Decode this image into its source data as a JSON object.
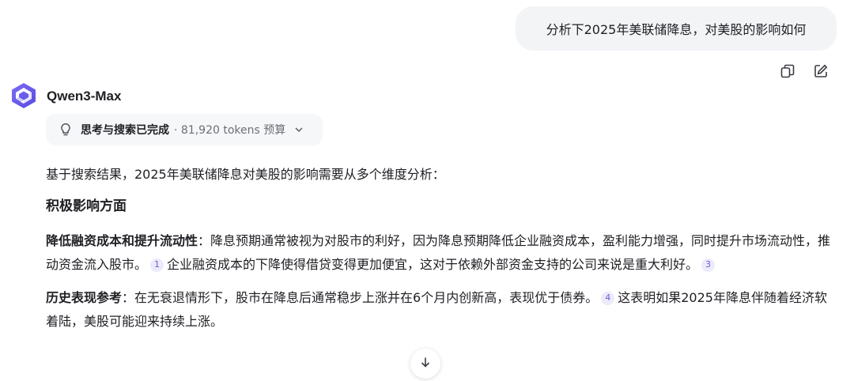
{
  "user_message": "分析下2025年美联储降息，对美股的影响如何",
  "actions": {
    "copy_icon": "copy-icon",
    "edit_icon": "edit-icon"
  },
  "model": {
    "name": "Qwen3-Max",
    "avatar_icon": "qwen-logo-icon"
  },
  "thinking": {
    "status": "思考与搜索已完成",
    "meta": "· 81,920 tokens 预算",
    "icon": "lightbulb-icon"
  },
  "answer": {
    "intro": "基于搜索结果，2025年美联储降息对美股的影响需要从多个维度分析：",
    "section_title": "积极影响方面",
    "para1": {
      "heading": "降低融资成本和提升流动性",
      "colon": "：",
      "text1": "降息预期通常被视为对股市的利好，因为降息预期降低企业融资成本，盈利能力增强，同时提升市场流动性，推动资金流入股市。",
      "cite1": "1",
      "text2": "企业融资成本的下降使得借贷变得更加便宜，这对于依赖外部资金支持的公司来说是重大利好。",
      "cite2": "3"
    },
    "para2": {
      "heading": "历史表现参考",
      "colon": "：",
      "text1": "在无衰退情形下，股市在降息后通常稳步上涨并在6个月内创新高，表现优于债券。",
      "cite1": "4",
      "text2": "这表明如果2025年降息伴随着经济软着陆，美股可能迎来持续上涨。"
    }
  },
  "colors": {
    "accent": "#6a5fd6",
    "bubble_bg": "#f3f4f6",
    "chip_bg": "#f6f7f9"
  }
}
